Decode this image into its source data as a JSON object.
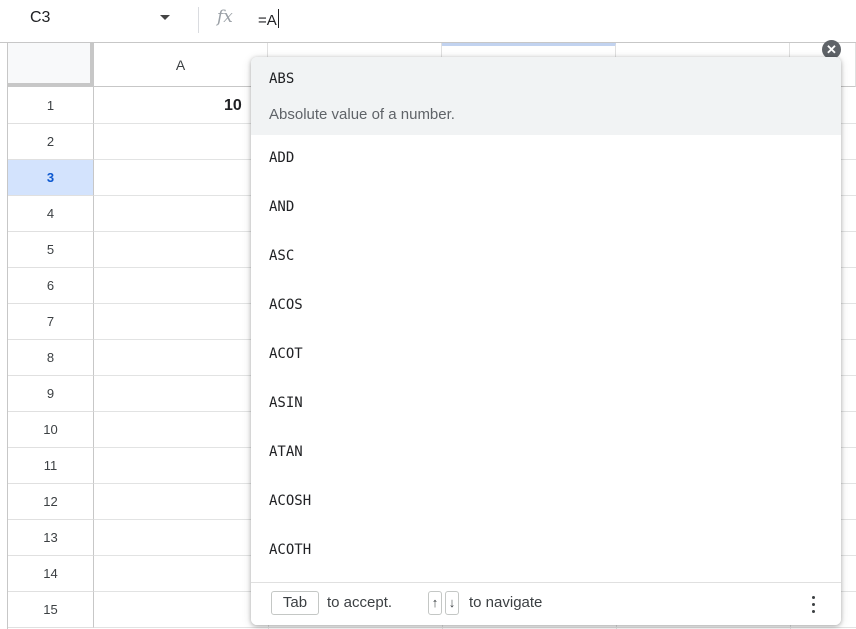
{
  "formula_bar": {
    "cell_ref": "C3",
    "fx_symbol": "fx",
    "formula": "=A"
  },
  "columns": [
    {
      "label": "A",
      "selected": false
    },
    {
      "label": "",
      "selected": false
    },
    {
      "label": "",
      "selected": true
    },
    {
      "label": "",
      "selected": false
    },
    {
      "label": "",
      "selected": false
    }
  ],
  "rows": [
    {
      "label": "1",
      "selected": false
    },
    {
      "label": "2",
      "selected": false
    },
    {
      "label": "3",
      "selected": true
    },
    {
      "label": "4",
      "selected": false
    },
    {
      "label": "5",
      "selected": false
    },
    {
      "label": "6",
      "selected": false
    },
    {
      "label": "7",
      "selected": false
    },
    {
      "label": "8",
      "selected": false
    },
    {
      "label": "9",
      "selected": false
    },
    {
      "label": "10",
      "selected": false
    },
    {
      "label": "11",
      "selected": false
    },
    {
      "label": "12",
      "selected": false
    },
    {
      "label": "13",
      "selected": false
    },
    {
      "label": "14",
      "selected": false
    },
    {
      "label": "15",
      "selected": false
    }
  ],
  "cells": {
    "a1_partial": "10"
  },
  "autocomplete": {
    "highlighted": {
      "name": "ABS",
      "description": "Absolute value of a number."
    },
    "items": [
      "ADD",
      "AND",
      "ASC",
      "ACOS",
      "ACOT",
      "ASIN",
      "ATAN",
      "ACOSH",
      "ACOTH"
    ],
    "footer": {
      "tab_key": "Tab",
      "accept_text": "to accept.",
      "up_key": "↑",
      "down_key": "↓",
      "navigate_text": "to navigate"
    }
  },
  "icons": {
    "close": "close-icon",
    "dropdown": "chevron-down-icon",
    "more": "more-vert-icon"
  },
  "colors": {
    "selected_row_bg": "#d3e3fd",
    "selected_text": "#0b57d0",
    "highlight_bg": "#f1f3f4"
  }
}
